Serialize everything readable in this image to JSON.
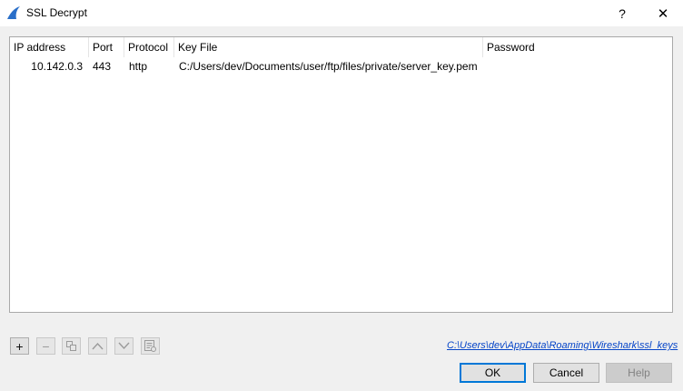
{
  "window": {
    "title": "SSL Decrypt",
    "help_glyph": "?",
    "close_glyph": "✕"
  },
  "table": {
    "headers": [
      "IP address",
      "Port",
      "Protocol",
      "Key File",
      "Password"
    ],
    "rows": [
      [
        "10.142.0.3",
        "443",
        "http",
        "C:/Users/dev/Documents/user/ftp/files/private/server_key.pem",
        ""
      ]
    ]
  },
  "toolbar": {
    "add_glyph": "+",
    "remove_glyph": "−",
    "copy_icon": "copy-icon",
    "up_icon": "chevron-up-icon",
    "down_icon": "chevron-down-icon",
    "clear_icon": "clear-list-icon"
  },
  "file_path": "C:\\Users\\dev\\AppData\\Roaming\\Wireshark\\ssl_keys",
  "buttons": {
    "ok": "OK",
    "cancel": "Cancel",
    "help": "Help"
  },
  "colors": {
    "accent": "#0078d7",
    "link": "#0645c8",
    "app_icon": "#2a6fc9"
  }
}
